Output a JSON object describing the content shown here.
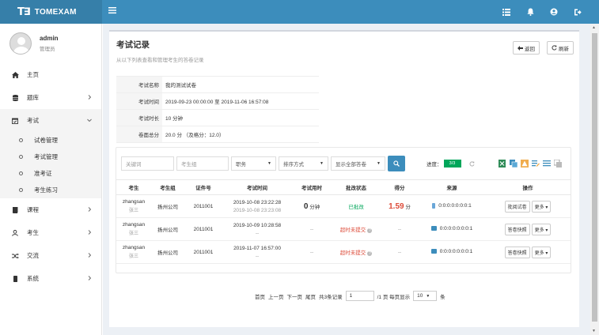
{
  "app": {
    "logo_mark": "T∃",
    "logo_text": "TOMEXAM"
  },
  "user": {
    "name": "admin",
    "role": "管理员"
  },
  "menu": {
    "home": "主页",
    "bank": "题库",
    "exam": "考试",
    "exam_sub": [
      "试卷管理",
      "考试管理",
      "准考证",
      "考生练习"
    ],
    "course": "课程",
    "candidate": "考生",
    "exchange": "交流",
    "system": "系统"
  },
  "page": {
    "title": "考试记录",
    "subtitle": "从以下列表查看和管理考生的答卷记录",
    "back_label": "返回",
    "refresh_label": "刷新"
  },
  "info": [
    {
      "key": "考试名称",
      "value": "我的测试试卷"
    },
    {
      "key": "考试时间",
      "value": "2019-09-23 00:00:00 至 2019-11-06 16:57:08"
    },
    {
      "key": "考试时长",
      "value": "10 分钟"
    },
    {
      "key": "卷面总分",
      "value": "20.0 分 （及格分：12.0）"
    }
  ],
  "filters": {
    "keyword_placeholder": "关键词",
    "group_placeholder": "考生组",
    "position": "职务",
    "sort": "排序方式",
    "show": "显示全部答卷"
  },
  "progress": {
    "label": "进度：",
    "value": "3/3",
    "fraction": 1.0
  },
  "table": {
    "headers": [
      "考生",
      "考生组",
      "证件号",
      "考试时间",
      "考试用时",
      "批改状态",
      "得分",
      "来源",
      "操作"
    ],
    "rows": [
      {
        "user": "zhangsan",
        "name": "张三",
        "group": "扬州公司",
        "id": "2011001",
        "time1": "2019-10-08 23:22:28",
        "time2": "2019-10-08 23:23:08",
        "duration": "0",
        "duration_unit": "分钟",
        "status": "已批改",
        "score": "1.59",
        "score_unit": "分",
        "source": "0:0:0:0:0:0:0:1",
        "op1": "批阅试卷",
        "op2": "更多"
      },
      {
        "user": "zhangsan",
        "name": "张三",
        "group": "扬州公司",
        "id": "2011001",
        "time1": "2019-10-09 10:28:58",
        "time2": "--",
        "duration": "--",
        "status": "超时未提交",
        "score": "--",
        "source": "0:0:0:0:0:0:0:1",
        "op1": "答卷快照",
        "op2": "更多"
      },
      {
        "user": "zhangsan",
        "name": "张三",
        "group": "扬州公司",
        "id": "2011001",
        "time1": "2019-11-07 16:57:00",
        "time2": "--",
        "duration": "--",
        "status": "超时未提交",
        "score": "--",
        "source": "0:0:0:0:0:0:0:1",
        "op1": "答卷快照",
        "op2": "更多"
      }
    ]
  },
  "pager": {
    "first": "首页",
    "prev": "上一页",
    "next": "下一页",
    "last": "尾页",
    "total": "共3条记录",
    "page": "1",
    "pages": "/1 页 每页显示",
    "per_page": "10",
    "unit": "条"
  },
  "colors": {
    "topbar": "#3c8dbc",
    "logo_bg": "#367fa9",
    "success": "#00a65a",
    "danger": "#dd4b39"
  }
}
